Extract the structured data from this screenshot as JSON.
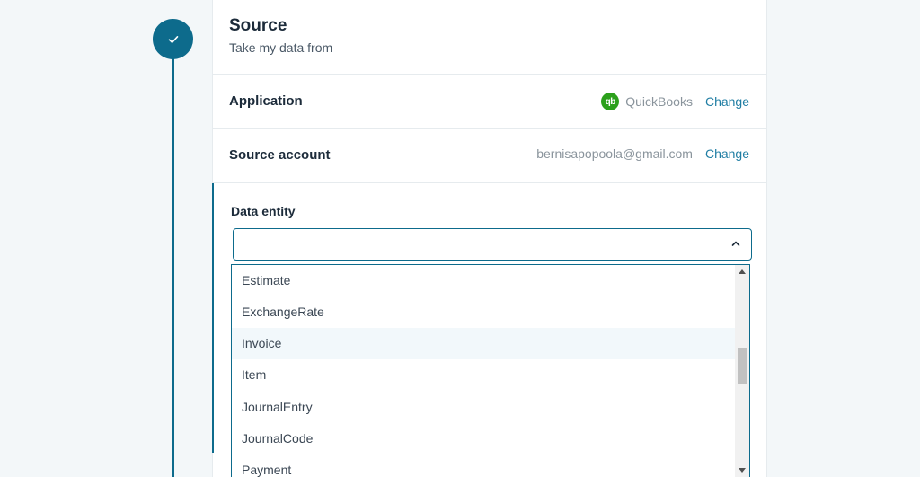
{
  "step": {
    "status_icon": "check-icon",
    "color": "#0d6b8c"
  },
  "source": {
    "title": "Source",
    "subtitle": "Take my data from"
  },
  "application": {
    "label": "Application",
    "app_logo_text": "qb",
    "app_name": "QuickBooks",
    "change_label": "Change"
  },
  "source_account": {
    "label": "Source account",
    "email": "bernisapopoola@gmail.com",
    "change_label": "Change"
  },
  "data_entity": {
    "label": "Data entity",
    "value": "",
    "options": [
      "Estimate",
      "ExchangeRate",
      "Invoice",
      "Item",
      "JournalEntry",
      "JournalCode",
      "Payment"
    ],
    "hovered_option": "Invoice"
  }
}
